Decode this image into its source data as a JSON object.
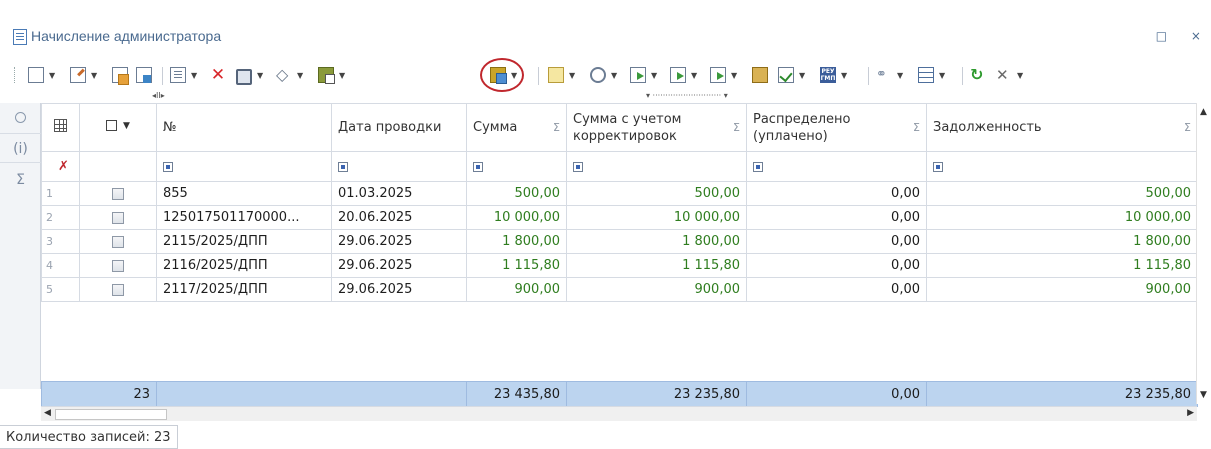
{
  "window": {
    "title": "Начисление администратора",
    "controls": "□ ×"
  },
  "toolbar": {
    "scroll_left_marker": "◂II▸",
    "scroll_mid_marker": "▾ ··························· ▾"
  },
  "sidepanel": {
    "info_label": "(i)",
    "sum_label": "Σ"
  },
  "grid": {
    "columns": [
      {
        "key": "num",
        "label": "№",
        "sigma": ""
      },
      {
        "key": "date",
        "label": "Дата проводки",
        "sigma": ""
      },
      {
        "key": "sum",
        "label": "Сумма",
        "sigma": "Σ"
      },
      {
        "key": "sum_adj",
        "label": "Сумма с учетом корректировок",
        "sigma": "Σ"
      },
      {
        "key": "distributed",
        "label": "Распределено (уплачено)",
        "sigma": "Σ"
      },
      {
        "key": "debt",
        "label": "Задолженность",
        "sigma": "Σ"
      }
    ],
    "rows": [
      {
        "idx": "1",
        "num": "855",
        "date": "01.03.2025",
        "sum": "500,00",
        "sum_adj": "500,00",
        "distributed": "0,00",
        "debt": "500,00"
      },
      {
        "idx": "2",
        "num": "125017501170000...",
        "date": "20.06.2025",
        "sum": "10 000,00",
        "sum_adj": "10 000,00",
        "distributed": "0,00",
        "debt": "10 000,00"
      },
      {
        "idx": "3",
        "num": "2115/2025/ДПП",
        "date": "29.06.2025",
        "sum": "1 800,00",
        "sum_adj": "1 800,00",
        "distributed": "0,00",
        "debt": "1 800,00"
      },
      {
        "idx": "4",
        "num": "2116/2025/ДПП",
        "date": "29.06.2025",
        "sum": "1 115,80",
        "sum_adj": "1 115,80",
        "distributed": "0,00",
        "debt": "1 115,80"
      },
      {
        "idx": "5",
        "num": "2117/2025/ДПП",
        "date": "29.06.2025",
        "sum": "900,00",
        "sum_adj": "900,00",
        "distributed": "0,00",
        "debt": "900,00"
      }
    ],
    "totals": {
      "count": "23",
      "sum": "23 435,80",
      "sum_adj": "23 235,80",
      "distributed": "0,00",
      "debt": "23 235,80"
    }
  },
  "status": {
    "records_label": "Количество записей: 23"
  },
  "colors": {
    "positive_amount": "#2f7d1f",
    "totals_row": "#bcd4ef",
    "highlight_ring": "#c0272d",
    "title_text": "#4a6a8f"
  }
}
